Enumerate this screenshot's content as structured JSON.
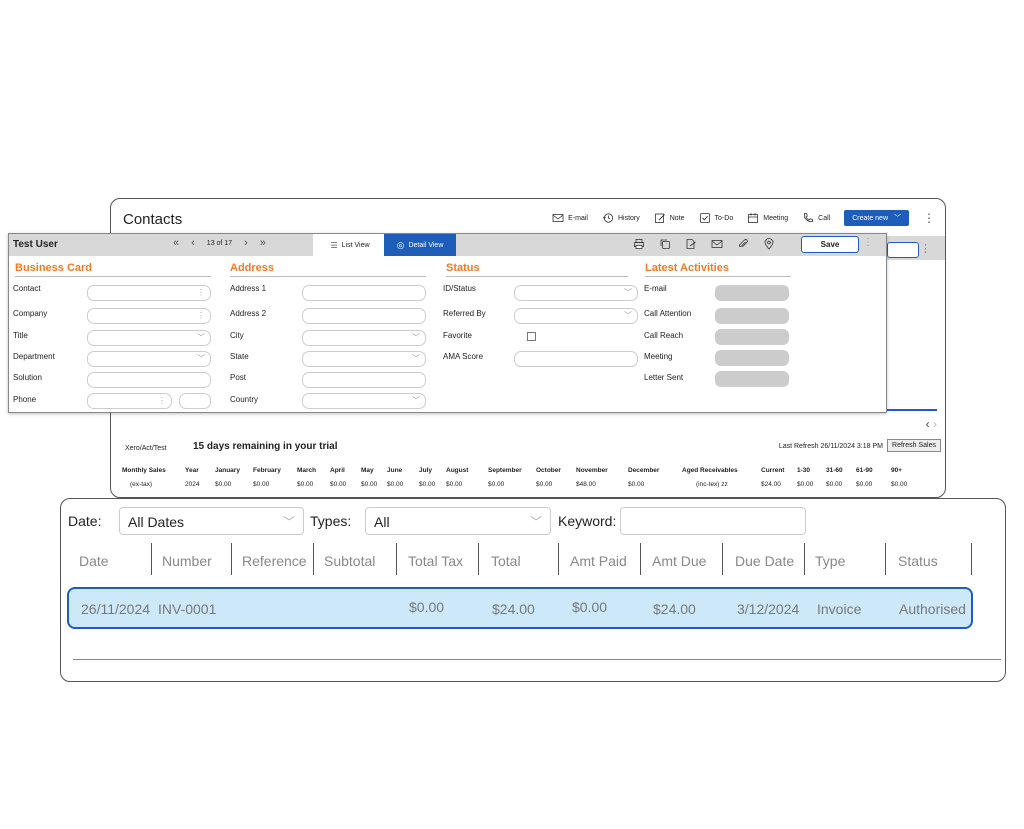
{
  "contacts": {
    "title": "Contacts",
    "toolbar": {
      "email": "E-mail",
      "history": "History",
      "note": "Note",
      "todo": "To-Do",
      "meeting": "Meeting",
      "call": "Call",
      "create_new": "Create new"
    },
    "trial": {
      "account": "Xero/Act/Test",
      "message": "15 days remaining in your trial",
      "last_refresh": "Last Refresh 26/11/2024 3:18 PM",
      "refresh_button": "Refresh Sales"
    },
    "sales": {
      "headers": [
        "Monthly Sales",
        "Year",
        "January",
        "February",
        "March",
        "April",
        "May",
        "June",
        "July",
        "August",
        "September",
        "October",
        "November",
        "December",
        "Aged Receivables",
        "Current",
        "1-30",
        "31-60",
        "61-90",
        "90+"
      ],
      "values": [
        "(ex-tax)",
        "2024",
        "$0.00",
        "$0.00",
        "$0.00",
        "$0.00",
        "$0.00",
        "$0.00",
        "$0.00",
        "$0.00",
        "$0.00",
        "$0.00",
        "$48.00",
        "$0.00",
        "(inc-tex) zz",
        "$24.00",
        "$0.00",
        "$0.00",
        "$0.00",
        "$0.00"
      ]
    }
  },
  "detail": {
    "name": "Test User",
    "pager": {
      "first": "«",
      "prev": "‹",
      "count": "13 of 17",
      "next": "›",
      "last": "»"
    },
    "list_view": "List View",
    "detail_view": "Detail View",
    "save": "Save",
    "sections": {
      "business_card": {
        "title": "Business Card",
        "fields": [
          "Contact",
          "Company",
          "Title",
          "Department",
          "Solution",
          "Phone"
        ]
      },
      "address": {
        "title": "Address",
        "fields": [
          "Address 1",
          "Address 2",
          "City",
          "State",
          "Post",
          "Country"
        ]
      },
      "status": {
        "title": "Status",
        "fields": [
          "ID/Status",
          "Referred By",
          "Favorite",
          "AMA Score"
        ]
      },
      "activities": {
        "title": "Latest Activities",
        "fields": [
          "E-mail",
          "Call Attention",
          "Call Reach",
          "Meeting",
          "Letter Sent"
        ]
      }
    }
  },
  "invoices": {
    "filters": {
      "date_label": "Date:",
      "date_value": "All Dates",
      "types_label": "Types:",
      "types_value": "All",
      "keyword_label": "Keyword:",
      "keyword_value": ""
    },
    "columns": [
      "Date",
      "Number",
      "Reference",
      "Subtotal",
      "Total Tax",
      "Total",
      "Amt Paid",
      "Amt Due",
      "Due Date",
      "Type",
      "Status"
    ],
    "rows": [
      {
        "date": "26/11/2024",
        "number": "INV-0001",
        "reference": "",
        "subtotal": "",
        "total_tax": "$0.00",
        "total": "$24.00",
        "amt_paid": "$0.00",
        "amt_due": "$24.00",
        "due_date": "3/12/2024",
        "type": "Invoice",
        "status": "Authorised"
      }
    ]
  }
}
